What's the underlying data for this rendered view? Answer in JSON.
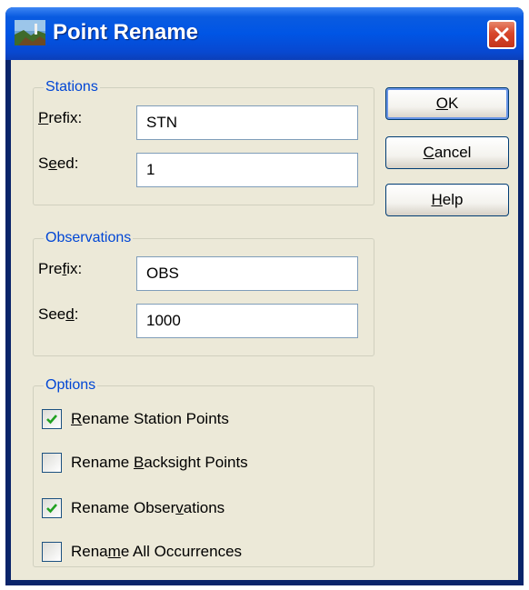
{
  "window": {
    "title": "Point Rename"
  },
  "stations": {
    "group_title": "Stations",
    "prefix_label": "Prefix:",
    "prefix_value": "STN",
    "seed_label": "Seed:",
    "seed_value": "1"
  },
  "observations": {
    "group_title": "Observations",
    "prefix_label": "Prefix:",
    "prefix_value": "OBS",
    "seed_label": "Seed:",
    "seed_value": "1000"
  },
  "options": {
    "group_title": "Options",
    "items": [
      {
        "label": "Rename Station Points",
        "checked": true
      },
      {
        "label": "Rename Backsight Points",
        "checked": false
      },
      {
        "label": "Rename Observations",
        "checked": true
      },
      {
        "label": "Rename All Occurrences",
        "checked": false
      }
    ]
  },
  "buttons": {
    "ok": "OK",
    "cancel": "Cancel",
    "help": "Help"
  },
  "colors": {
    "title_bar": "#0055e5",
    "dialog_bg": "#ece9d8",
    "group_title": "#0046d5",
    "close_button": "#d8462a"
  }
}
